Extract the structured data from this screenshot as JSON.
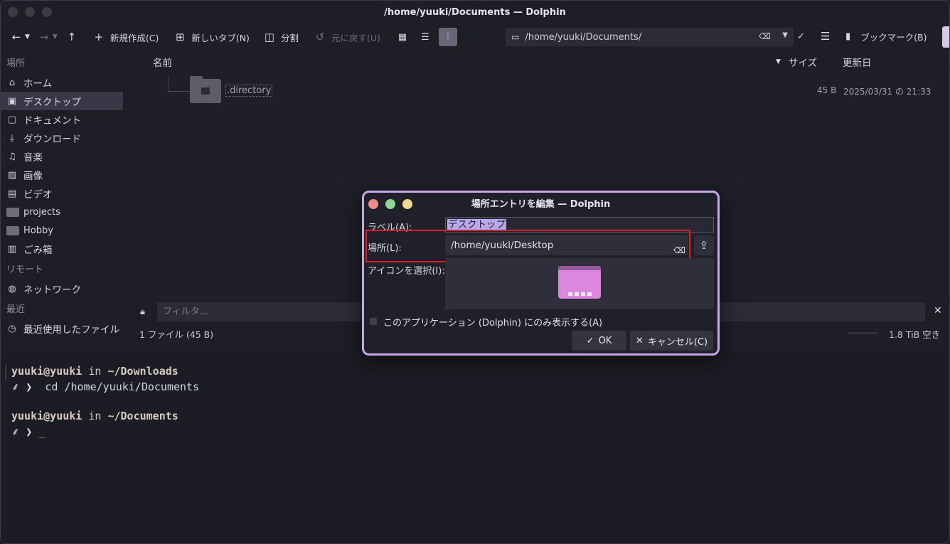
{
  "window": {
    "title": "/home/yuuki/Documents — Dolphin"
  },
  "toolbar": {
    "back_icon": "←",
    "forward_icon": "→",
    "up_icon": "↑",
    "new_label": "新規作成(C)",
    "new_tab_label": "新しいタブ(N)",
    "split_label": "分割",
    "undo_label": "元に戻す(U)",
    "path": "/home/yuuki/Documents/",
    "bookmarks_label": "ブックマーク(B)"
  },
  "sidebar": {
    "places_title": "場所",
    "items": [
      {
        "label": "ホーム",
        "icon": "⌂"
      },
      {
        "label": "デスクトップ",
        "icon": "▣"
      },
      {
        "label": "ドキュメント",
        "icon": "▢"
      },
      {
        "label": "ダウンロード",
        "icon": "⤓"
      },
      {
        "label": "音楽",
        "icon": "♫"
      },
      {
        "label": "画像",
        "icon": "▨"
      },
      {
        "label": "ビデオ",
        "icon": "▤"
      },
      {
        "label": "projects",
        "icon": "folder"
      },
      {
        "label": "Hobby",
        "icon": "folder"
      },
      {
        "label": "ごみ箱",
        "icon": "🗑"
      }
    ],
    "remote_title": "リモート",
    "network_label": "ネットワーク",
    "recent_title": "最近",
    "recent_label": "最近使用したファイル"
  },
  "fileview": {
    "col_name": "名前",
    "col_size": "サイズ",
    "col_date": "更新日",
    "files": [
      {
        "name": ".directory",
        "size": "45 B",
        "date": "2025/03/31 の 21:33"
      }
    ]
  },
  "filter": {
    "placeholder": "フィルタ..."
  },
  "status": {
    "left": "1 ファイル (45 B)",
    "right": "1.8 TiB 空き"
  },
  "terminal": {
    "line1_user": "yuuki@yuuki",
    "line1_in": " in ",
    "line1_dir": "~/Downloads",
    "line2_prompt": "⸙ ❯ ",
    "line2_cmd": " cd /home/yuuki/Documents",
    "line3_user": "yuuki@yuuki",
    "line3_in": " in ",
    "line3_dir": "~/Documents",
    "line4_prompt": "⸙ ❯ ",
    "line4_cursor": "_"
  },
  "dialog": {
    "title": "場所エントリを編集 — Dolphin",
    "label_label": "ラベル(A):",
    "label_value": "デスクトップ",
    "location_label": "場所(L):",
    "location_value": "/home/yuuki/Desktop",
    "icon_label": "アイコンを選択(I):",
    "checkbox_label": "このアプリケーション (Dolphin) にのみ表示する(A)",
    "ok_label": "OK",
    "cancel_label": "キャンセル(C)"
  }
}
